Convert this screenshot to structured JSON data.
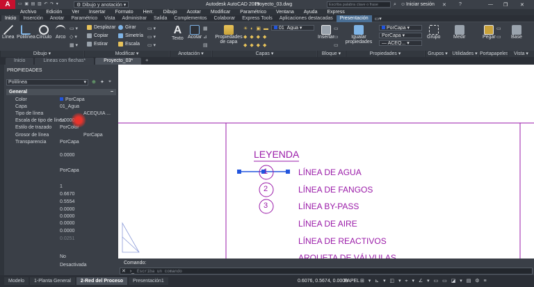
{
  "titlebar": {
    "app_title": "Autodesk AutoCAD 2019",
    "file_name": "Proyecto_03.dwg",
    "workspace": "Dibujo y anotación",
    "search_placeholder": "Escriba palabra clave o frase",
    "signin_label": "Iniciar sesión"
  },
  "menubar": [
    "Archivo",
    "Edición",
    "Ver",
    "Insertar",
    "Formato",
    "Herr.",
    "Dibujo",
    "Acotar",
    "Modificar",
    "Paramétrico",
    "Ventana",
    "Ayuda",
    "Express"
  ],
  "ribbon_tabs": [
    "Inicio",
    "Inserción",
    "Anotar",
    "Paramétrico",
    "Vista",
    "Administrar",
    "Salida",
    "Complementos",
    "Colaborar",
    "Express Tools",
    "Aplicaciones destacadas",
    "Presentación"
  ],
  "active_ribbon_tab": "Inicio",
  "ribbon": {
    "dibujo": {
      "label": "Dibujo",
      "linea": "Línea",
      "polilinea": "Polilínea",
      "circulo": "Círculo",
      "arco": "Arco"
    },
    "modificar": {
      "label": "Modificar",
      "desplazar": "Desplazar",
      "girar": "Girar",
      "copiar": "Copiar",
      "simetria": "Simetría",
      "estirar": "Estirar",
      "escala": "Escala"
    },
    "anotacion": {
      "label": "Anotación",
      "texto": "Texto",
      "acotar": "Acotar"
    },
    "capas": {
      "label": "Capas",
      "props_capa": "Propiedades de capa",
      "layer_value": "01_Agua"
    },
    "bloque": {
      "label": "Bloque",
      "insertar": "Insertar"
    },
    "propiedades": {
      "label": "Propiedades",
      "igualar": "Igualar propiedades",
      "color": "PorCapa",
      "lineweight": "PorCapa",
      "linetype": "ACEQ..."
    },
    "grupos": {
      "label": "Grupos",
      "grupo": "Grupo"
    },
    "utilidades": {
      "label": "Utilidades",
      "medir": "Medir"
    },
    "portapapeles": {
      "label": "Portapapeles",
      "pegar": "Pegar"
    },
    "vista": {
      "label": "Vista",
      "base": "Base"
    }
  },
  "doc_tabs": [
    "Inicio",
    "Lineas con flechas*",
    "Proyecto_03*"
  ],
  "active_doc_tab": "Proyecto_03*",
  "properties": {
    "title": "PROPIEDADES",
    "selection": "Polilínea",
    "section_general": "General",
    "rows": [
      {
        "label": "Color",
        "value": "PorCapa"
      },
      {
        "label": "Capa",
        "value": "01_Agua"
      },
      {
        "label": "Tipo de línea",
        "value": "ACEQUIA ..."
      },
      {
        "label": "Escala de tipo de línea",
        "value": "1.0000"
      },
      {
        "label": "Estilo de trazado",
        "value": "PorColor"
      },
      {
        "label": "Grosor de línea",
        "value": "PorCapa"
      },
      {
        "label": "Transparencia",
        "value": "PorCapa"
      }
    ],
    "extra_values": [
      "0.0000",
      "PorCapa",
      "1",
      "0.6670",
      "0.5554",
      "0.0000",
      "0.0000",
      "0.0000",
      "0.0000",
      "0.0251",
      "No",
      "Desactivada"
    ]
  },
  "drawing": {
    "legend_title": "LEYENDA",
    "items": [
      {
        "num": "1",
        "text": "LÍNEA DE AGUA"
      },
      {
        "num": "2",
        "text": "LÍNEA DE FANGOS"
      },
      {
        "num": "3",
        "text": "LÍNEA BY-PASS"
      },
      {
        "num": "",
        "text": "LÍNEA DE AIRE"
      },
      {
        "num": "",
        "text": "LÍNEA DE REACTIVOS"
      },
      {
        "num": "",
        "text": "ARQUETA DE VÁLVULAS"
      }
    ],
    "drawing_color": "#9a1aa8"
  },
  "command": {
    "label": "Comando:",
    "placeholder": "Escriba un comando"
  },
  "layout_tabs": [
    "Modelo",
    "1-Planta General",
    "2-Red del Proceso",
    "Presentación1"
  ],
  "active_layout_tab": "2-Red del Proceso",
  "status": {
    "coords": "0.6076, 0.5674, 0.0000",
    "space": "PAPEL"
  }
}
